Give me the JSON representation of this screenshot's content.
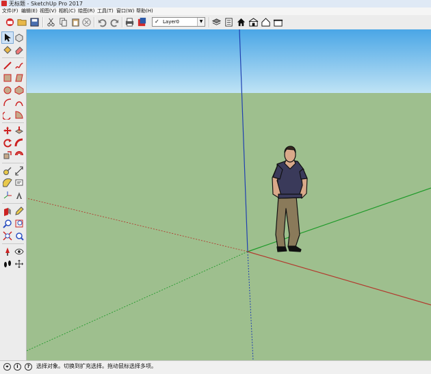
{
  "window": {
    "title": "无标题 - SketchUp Pro 2017"
  },
  "menubar": {
    "items": [
      "文件(F)",
      "编辑(E)",
      "视图(V)",
      "相机(C)",
      "绘图(R)",
      "工具(T)",
      "窗口(W)",
      "帮助(H)"
    ]
  },
  "toolbar": {
    "layer_combo": {
      "value": "Layer0",
      "check": "✓"
    },
    "icons": [
      "get-models-icon",
      "open-icon",
      "save-icon",
      "cut-icon",
      "copy-icon",
      "erase-icon",
      "undo-icon",
      "redo-icon",
      "print-icon",
      "model-info-icon",
      "layers-icon",
      "components-icon",
      "house-icon",
      "house-front-icon",
      "house-outline-icon",
      "house-side-icon"
    ]
  },
  "left_toolbar": {
    "icons": [
      "select-icon",
      "make-component-icon",
      "paint-bucket-icon",
      "eraser-icon",
      "line-icon",
      "freehand-icon",
      "rectangle-icon",
      "rotated-rectangle-icon",
      "circle-icon",
      "polygon-icon",
      "arc-icon",
      "two-point-arc-icon",
      "three-point-arc-icon",
      "pie-icon",
      "move-icon",
      "push-pull-icon",
      "rotate-icon",
      "follow-me-icon",
      "scale-icon",
      "offset-icon",
      "tape-measure-icon",
      "dimension-icon",
      "protractor-icon",
      "text-icon",
      "axes-icon",
      "3d-text-icon",
      "section-plane-icon",
      "paint-icon",
      "zoom-icon",
      "zoom-window-icon",
      "zoom-extents-icon",
      "previous-view-icon",
      "position-camera-icon",
      "look-around-icon",
      "walk-icon",
      "orbit-icon"
    ]
  },
  "statusbar": {
    "text": "选择对象。切换到扩充选择。拖动鼠标选择多项。",
    "icons": [
      "geolocation-icon",
      "info-icon",
      "help-icon"
    ]
  },
  "viewport": {
    "sky_top": "#4aa6e6",
    "sky_bottom": "#bfe3f5",
    "ground": "#9ebf8e",
    "axis_red": "#b23a2e",
    "axis_green": "#1f9a2a",
    "axis_blue": "#1f3fb0"
  }
}
